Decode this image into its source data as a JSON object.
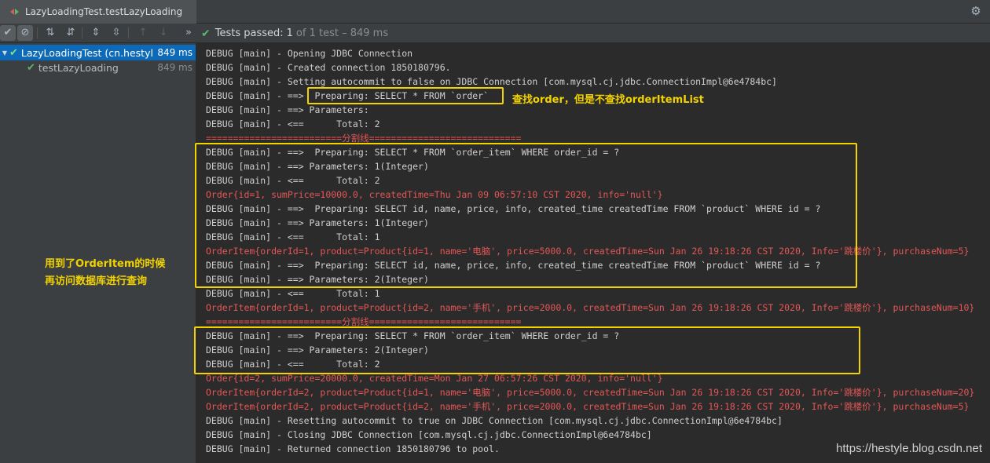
{
  "tab": {
    "title": "LazyLoadingTest.testLazyLoading",
    "icon": "run-config-icon"
  },
  "toolbar": {
    "buttons": [
      {
        "icon": "show-passed-icon",
        "glyph": "✔"
      },
      {
        "icon": "show-ignored-icon",
        "glyph": "⊘"
      },
      {
        "icon": "sort-alpha-icon",
        "glyph": "⇅"
      },
      {
        "icon": "sort-duration-icon",
        "glyph": "⇵"
      },
      {
        "icon": "expand-all-icon",
        "glyph": "⇕"
      },
      {
        "icon": "collapse-all-icon",
        "glyph": "⇳"
      },
      {
        "icon": "prev-failed-icon",
        "glyph": "↑"
      },
      {
        "icon": "next-failed-icon",
        "glyph": "↓"
      },
      {
        "icon": "more-icon",
        "glyph": "»"
      }
    ],
    "status_prefix": "Tests passed:",
    "status_count": "1",
    "status_suffix": "of 1 test – 849 ms"
  },
  "tree": {
    "items": [
      {
        "label": "LazyLoadingTest (cn.hestyl",
        "duration": "849 ms",
        "selected": true
      },
      {
        "label": "testLazyLoading",
        "duration": "849 ms",
        "selected": false
      }
    ]
  },
  "console": {
    "lines": [
      {
        "t": "DEBUG [main] - Opening JDBC Connection",
        "k": "debug"
      },
      {
        "t": "DEBUG [main] - Created connection 1850180796.",
        "k": "debug"
      },
      {
        "t": "DEBUG [main] - Setting autocommit to false on JDBC Connection [com.mysql.cj.jdbc.ConnectionImpl@6e4784bc]",
        "k": "debug"
      },
      {
        "t": "DEBUG [main] - ==>  Preparing: SELECT * FROM `order`",
        "k": "debug"
      },
      {
        "t": "DEBUG [main] - ==> Parameters: ",
        "k": "debug"
      },
      {
        "t": "DEBUG [main] - <==      Total: 2",
        "k": "debug"
      },
      {
        "t": "=========================分割线============================",
        "k": "sep"
      },
      {
        "t": "DEBUG [main] - ==>  Preparing: SELECT * FROM `order_item` WHERE order_id = ?",
        "k": "debug"
      },
      {
        "t": "DEBUG [main] - ==> Parameters: 1(Integer)",
        "k": "debug"
      },
      {
        "t": "DEBUG [main] - <==      Total: 2",
        "k": "debug"
      },
      {
        "t": "Order{id=1, sumPrice=10000.0, createdTime=Thu Jan 09 06:57:10 CST 2020, info='null'}",
        "k": "red"
      },
      {
        "t": "DEBUG [main] - ==>  Preparing: SELECT id, name, price, info, created_time createdTime FROM `product` WHERE id = ?",
        "k": "debug"
      },
      {
        "t": "DEBUG [main] - ==> Parameters: 1(Integer)",
        "k": "debug"
      },
      {
        "t": "DEBUG [main] - <==      Total: 1",
        "k": "debug"
      },
      {
        "t": "OrderItem{orderId=1, product=Product{id=1, name='电脑', price=5000.0, createdTime=Sun Jan 26 19:18:26 CST 2020, Info='跳楼价'}, purchaseNum=5}",
        "k": "red"
      },
      {
        "t": "DEBUG [main] - ==>  Preparing: SELECT id, name, price, info, created_time createdTime FROM `product` WHERE id = ?",
        "k": "debug"
      },
      {
        "t": "DEBUG [main] - ==> Parameters: 2(Integer)",
        "k": "debug"
      },
      {
        "t": "DEBUG [main] - <==      Total: 1",
        "k": "debug"
      },
      {
        "t": "OrderItem{orderId=1, product=Product{id=2, name='手机', price=2000.0, createdTime=Sun Jan 26 19:18:26 CST 2020, Info='跳楼价'}, purchaseNum=10}",
        "k": "red"
      },
      {
        "t": "=========================分割线============================",
        "k": "sep"
      },
      {
        "t": "DEBUG [main] - ==>  Preparing: SELECT * FROM `order_item` WHERE order_id = ?",
        "k": "debug"
      },
      {
        "t": "DEBUG [main] - ==> Parameters: 2(Integer)",
        "k": "debug"
      },
      {
        "t": "DEBUG [main] - <==      Total: 2",
        "k": "debug"
      },
      {
        "t": "Order{id=2, sumPrice=20000.0, createdTime=Mon Jan 27 06:57:26 CST 2020, info='null'}",
        "k": "red"
      },
      {
        "t": "OrderItem{orderId=2, product=Product{id=1, name='电脑', price=5000.0, createdTime=Sun Jan 26 19:18:26 CST 2020, Info='跳楼价'}, purchaseNum=20}",
        "k": "red"
      },
      {
        "t": "OrderItem{orderId=2, product=Product{id=2, name='手机', price=2000.0, createdTime=Sun Jan 26 19:18:26 CST 2020, Info='跳楼价'}, purchaseNum=5}",
        "k": "red"
      },
      {
        "t": "DEBUG [main] - Resetting autocommit to true on JDBC Connection [com.mysql.cj.jdbc.ConnectionImpl@6e4784bc]",
        "k": "debug"
      },
      {
        "t": "DEBUG [main] - Closing JDBC Connection [com.mysql.cj.jdbc.ConnectionImpl@6e4784bc]",
        "k": "debug"
      },
      {
        "t": "DEBUG [main] - Returned connection 1850180796 to pool.",
        "k": "debug"
      }
    ]
  },
  "annotations": {
    "order_note": "查找order，但是不查找orderItemList",
    "lazy_note_line1": "用到了OrderItem的时候",
    "lazy_note_line2": "再访问数据库进行查询",
    "color": "#f2d300"
  },
  "watermark": "https://hestyle.blog.csdn.net"
}
